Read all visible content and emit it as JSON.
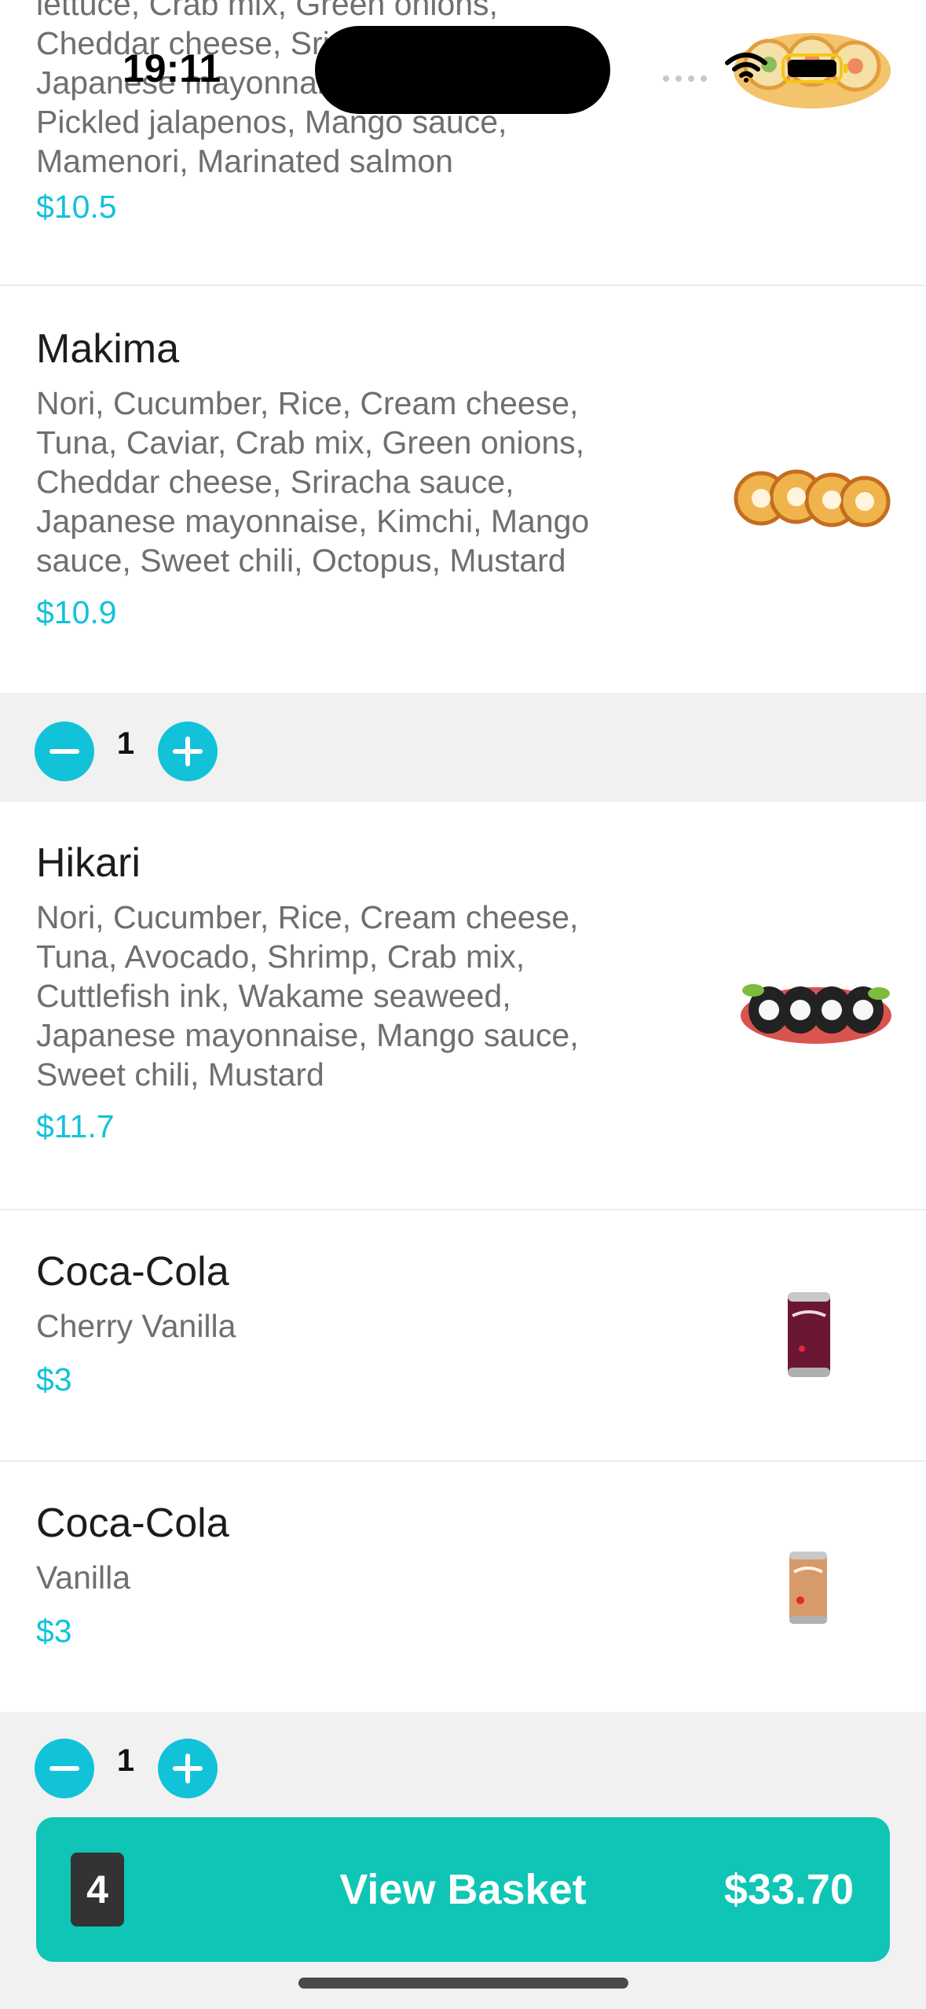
{
  "status_bar": {
    "time": "19:11"
  },
  "items": [
    {
      "description_lines": [
        "lettuce, Crab mix, Green onions,",
        "Cheddar cheese, Sriracha",
        "Japanese mayonnaise,",
        "Pickled jalapenos, Mango sauce,",
        "Mamenori, Marinated salmon"
      ],
      "price": "$10.5",
      "image_icon": "sushi-rolls-image"
    },
    {
      "name": "Makima",
      "description_lines": [
        "Nori, Cucumber, Rice, Cream cheese,",
        "Tuna, Caviar, Crab mix, Green onions,",
        "Cheddar cheese, Sriracha sauce,",
        "Japanese mayonnaise, Kimchi, Mango",
        "sauce, Sweet chili, Octopus, Mustard"
      ],
      "price": "$10.9",
      "image_icon": "sushi-rolls-image",
      "quantity": "1"
    },
    {
      "name": "Hikari",
      "description_lines": [
        "Nori, Cucumber, Rice, Cream cheese,",
        "Tuna, Avocado, Shrimp, Crab mix,",
        "Cuttlefish ink, Wakame seaweed,",
        "Japanese mayonnaise, Mango sauce,",
        "Sweet chili, Mustard"
      ],
      "price": "$11.7",
      "image_icon": "sushi-rolls-image"
    },
    {
      "name": "Coca-Cola",
      "description_lines": [
        "Cherry Vanilla"
      ],
      "price": "$3",
      "image_icon": "soda-can-image"
    },
    {
      "name": "Coca-Cola",
      "description_lines": [
        "Vanilla"
      ],
      "price": "$3",
      "image_icon": "soda-can-image",
      "quantity": "1"
    }
  ],
  "basket": {
    "count": "4",
    "label": "View Basket",
    "total": "$33.70"
  },
  "colors": {
    "accent": "#12c2d9",
    "basket_button": "#0fc5b6"
  }
}
